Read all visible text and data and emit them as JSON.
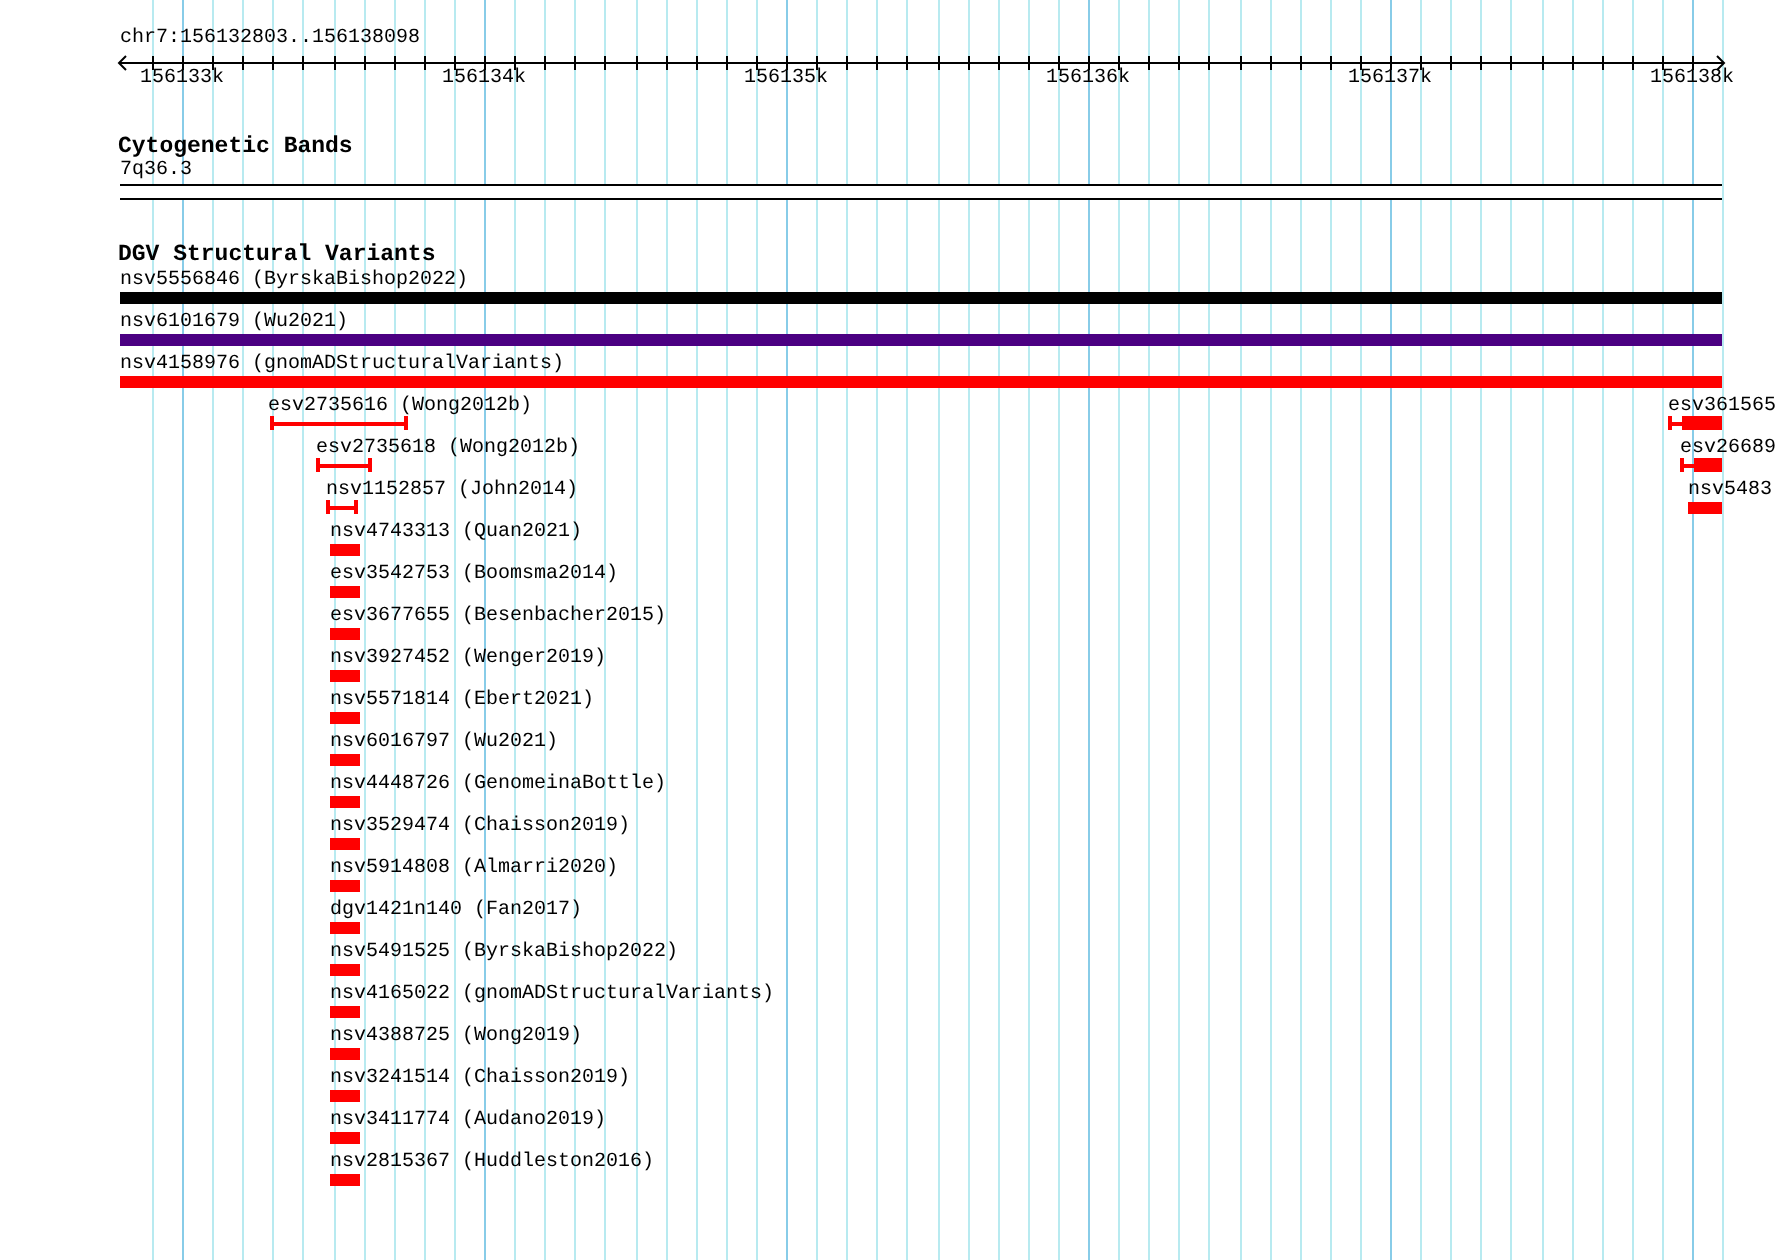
{
  "ruler": {
    "location": "chr7:156132803..156138098",
    "ticks": [
      "156133k",
      "156134k",
      "156135k",
      "156136k",
      "156137k",
      "156138k"
    ]
  },
  "tracks": [
    {
      "title": "Cytogenetic Bands",
      "rows": [
        {
          "features": [
            {
              "label": "7q36.3",
              "kind": "band",
              "color": "#000000"
            }
          ]
        }
      ]
    },
    {
      "title": "DGV Structural Variants",
      "rows": [
        {
          "features": [
            {
              "label": "nsv5556846 (ByrskaBishop2022)",
              "kind": "block",
              "color": "#000000"
            }
          ]
        },
        {
          "features": [
            {
              "label": "nsv6101679 (Wu2021)",
              "kind": "block",
              "color": "#4b0082"
            }
          ]
        },
        {
          "features": [
            {
              "label": "nsv4158976 (gnomADStructuralVariants)",
              "kind": "block",
              "color": "#ff0000"
            }
          ]
        },
        {
          "features": [
            {
              "label": "esv2735616 (Wong2012b)",
              "kind": "range",
              "color": "#ff0000"
            },
            {
              "label": "esv361565",
              "kind": "capped-block",
              "color": "#ff0000"
            }
          ]
        },
        {
          "features": [
            {
              "label": "esv2735618 (Wong2012b)",
              "kind": "range",
              "color": "#ff0000"
            },
            {
              "label": "esv26689",
              "kind": "capped-block",
              "color": "#ff0000"
            }
          ]
        },
        {
          "features": [
            {
              "label": "nsv1152857 (John2014)",
              "kind": "range",
              "color": "#ff0000"
            },
            {
              "label": "nsv5483",
              "kind": "block",
              "color": "#ff0000"
            }
          ]
        },
        {
          "features": [
            {
              "label": "nsv4743313 (Quan2021)",
              "kind": "block",
              "color": "#ff0000"
            }
          ]
        },
        {
          "features": [
            {
              "label": "esv3542753 (Boomsma2014)",
              "kind": "block",
              "color": "#ff0000"
            }
          ]
        },
        {
          "features": [
            {
              "label": "esv3677655 (Besenbacher2015)",
              "kind": "block",
              "color": "#ff0000"
            }
          ]
        },
        {
          "features": [
            {
              "label": "nsv3927452 (Wenger2019)",
              "kind": "block",
              "color": "#ff0000"
            }
          ]
        },
        {
          "features": [
            {
              "label": "nsv5571814 (Ebert2021)",
              "kind": "block",
              "color": "#ff0000"
            }
          ]
        },
        {
          "features": [
            {
              "label": "nsv6016797 (Wu2021)",
              "kind": "block",
              "color": "#ff0000"
            }
          ]
        },
        {
          "features": [
            {
              "label": "nsv4448726 (GenomeinaBottle)",
              "kind": "block",
              "color": "#ff0000"
            }
          ]
        },
        {
          "features": [
            {
              "label": "nsv3529474 (Chaisson2019)",
              "kind": "block",
              "color": "#ff0000"
            }
          ]
        },
        {
          "features": [
            {
              "label": "nsv5914808 (Almarri2020)",
              "kind": "block",
              "color": "#ff0000"
            }
          ]
        },
        {
          "features": [
            {
              "label": "dgv1421n140 (Fan2017)",
              "kind": "block",
              "color": "#ff0000"
            }
          ]
        },
        {
          "features": [
            {
              "label": "nsv5491525 (ByrskaBishop2022)",
              "kind": "block",
              "color": "#ff0000"
            }
          ]
        },
        {
          "features": [
            {
              "label": "nsv4165022 (gnomADStructuralVariants)",
              "kind": "block",
              "color": "#ff0000"
            }
          ]
        },
        {
          "features": [
            {
              "label": "nsv4388725 (Wong2019)",
              "kind": "block",
              "color": "#ff0000"
            }
          ]
        },
        {
          "features": [
            {
              "label": "nsv3241514 (Chaisson2019)",
              "kind": "block",
              "color": "#ff0000"
            }
          ]
        },
        {
          "features": [
            {
              "label": "nsv3411774 (Audano2019)",
              "kind": "block",
              "color": "#ff0000"
            }
          ]
        },
        {
          "features": [
            {
              "label": "nsv2815367 (Huddleston2016)",
              "kind": "block",
              "color": "#ff0000"
            }
          ]
        }
      ]
    }
  ]
}
